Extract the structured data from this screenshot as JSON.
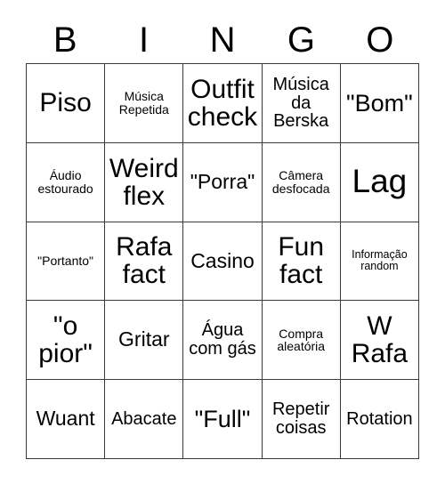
{
  "card": {
    "title": "BINGO",
    "header_letters": [
      "B",
      "I",
      "N",
      "G",
      "O"
    ],
    "columns": 5,
    "rows": 5,
    "colors": {
      "background": "#ffffff",
      "text": "#000000",
      "grid_line": "#3a3a3a"
    },
    "cells": [
      [
        {
          "text": "Piso",
          "size": "fs-xl"
        },
        {
          "text": "Música Repetida",
          "size": "fs-xs"
        },
        {
          "text": "Outfit check",
          "size": "fs-xl"
        },
        {
          "text": "Música da Berska",
          "size": "fs-sm"
        },
        {
          "text": "\"Bom\"",
          "size": "fs-lg"
        }
      ],
      [
        {
          "text": "Áudio estourado",
          "size": "fs-xs"
        },
        {
          "text": "Weird flex",
          "size": "fs-xl"
        },
        {
          "text": "\"Porra\"",
          "size": "fs-md"
        },
        {
          "text": "Câmera desfocada",
          "size": "fs-xs"
        },
        {
          "text": "Lag",
          "size": "fs-xxl"
        }
      ],
      [
        {
          "text": "\"Portanto\"",
          "size": "fs-xs"
        },
        {
          "text": "Rafa fact",
          "size": "fs-xl"
        },
        {
          "text": "Casino",
          "size": "fs-md"
        },
        {
          "text": "Fun fact",
          "size": "fs-xl"
        },
        {
          "text": "Informação random",
          "size": "fs-xxs"
        }
      ],
      [
        {
          "text": "\"o pior\"",
          "size": "fs-xl"
        },
        {
          "text": "Gritar",
          "size": "fs-md"
        },
        {
          "text": "Água com gás",
          "size": "fs-sm"
        },
        {
          "text": "Compra aleatória",
          "size": "fs-xs"
        },
        {
          "text": "W Rafa",
          "size": "fs-xl"
        }
      ],
      [
        {
          "text": "Wuant",
          "size": "fs-md"
        },
        {
          "text": "Abacate",
          "size": "fs-sm"
        },
        {
          "text": "\"Full\"",
          "size": "fs-lg"
        },
        {
          "text": "Repetir coisas",
          "size": "fs-sm"
        },
        {
          "text": "Rotation",
          "size": "fs-sm"
        }
      ]
    ]
  }
}
